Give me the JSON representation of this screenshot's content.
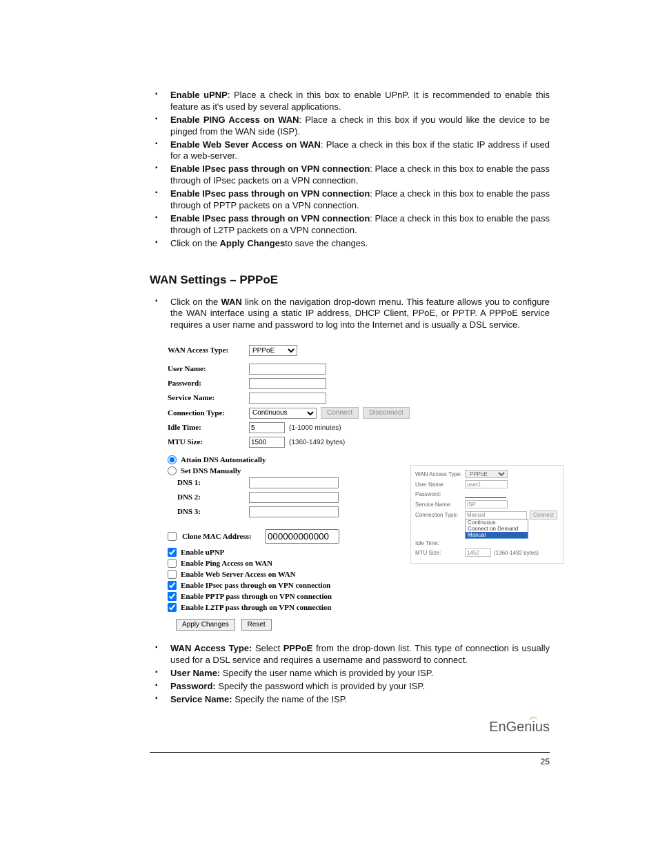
{
  "upper_bullets": [
    {
      "bold": "Enable uPNP",
      "rest": ": Place a check in this box to enable UPnP. It is recommended to enable this feature as it's used by several applications."
    },
    {
      "bold": "Enable PING Access on WAN",
      "rest": ": Place a check in this box if you would like the device to be pinged from the WAN side (ISP)."
    },
    {
      "bold": "Enable Web Sever Access on WAN",
      "rest": ": Place a check in this box if the static IP address if used for a web-server."
    },
    {
      "bold": "Enable IPsec pass through on VPN connection",
      "rest": ": Place a check in this box to enable the pass through of IPsec packets on a VPN connection."
    },
    {
      "bold": "Enable IPsec pass through on VPN connection",
      "rest": ": Place a check in this box to enable the pass through of PPTP packets on a VPN connection."
    },
    {
      "bold": "Enable IPsec pass through on VPN connection",
      "rest": ": Place a check in this box to enable the pass through of L2TP packets on a VPN connection."
    },
    {
      "plain_pre": "Click on the ",
      "bold": "Apply Changes",
      "rest": "to save the changes."
    }
  ],
  "heading": "WAN Settings – PPPoE",
  "wan_intro": {
    "pre": "Click on the ",
    "bold": "WAN",
    "rest": " link on the navigation drop-down menu. This feature allows you to configure the WAN interface using a static IP address, DHCP Client, PPoE, or PPTP. A PPPoE service requires a user name and password to log into the Internet and is usually a DSL service."
  },
  "form": {
    "wan_access_type_label": "WAN Access Type:",
    "wan_access_type_value": "PPPoE",
    "user_name_label": "User Name:",
    "user_name_value": "",
    "password_label": "Password:",
    "password_value": "",
    "service_name_label": "Service Name:",
    "service_name_value": "",
    "connection_type_label": "Connection Type:",
    "connection_type_value": "Continuous",
    "connect_btn": "Connect",
    "disconnect_btn": "Disconnect",
    "idle_time_label": "Idle Time:",
    "idle_time_value": "5",
    "idle_time_hint": "(1-1000 minutes)",
    "mtu_label": "MTU Size:",
    "mtu_value": "1500",
    "mtu_hint": "(1360-1492 bytes)",
    "attain_dns_label": "Attain DNS Automatically",
    "set_dns_label": "Set DNS Manually",
    "dns1_label": "DNS 1:",
    "dns2_label": "DNS 2:",
    "dns3_label": "DNS 3:",
    "clone_mac_label": "Clone MAC Address:",
    "clone_mac_value": "000000000000",
    "upnp_label": "Enable uPNP",
    "ping_label": "Enable Ping Access on WAN",
    "websrv_label": "Enable Web Server Access on WAN",
    "ipsec_label": "Enable IPsec pass through on VPN connection",
    "pptp_label": "Enable PPTP pass through on VPN connection",
    "l2tp_label": "Enable L2TP pass through on VPN connection",
    "apply_btn": "Apply Changes",
    "reset_btn": "Reset"
  },
  "inset": {
    "wan_access_type_label": "WAN Access Type:",
    "wan_access_type_value": "PPPoE",
    "user_name_label": "User Name:",
    "user_name_value": "user1",
    "password_label": "Password:",
    "service_name_label": "Service Name:",
    "service_name_value": "ISP",
    "connection_type_label": "Connection Type:",
    "connection_type_value": "Manual",
    "connect_btn": "Connect",
    "options": [
      "Continuous",
      "Connect on Demand",
      "Manual"
    ],
    "idle_time_label": "Idle Time:",
    "mtu_label": "MTU Size:",
    "mtu_value": "1452",
    "mtu_hint": "(1360-1492 bytes)"
  },
  "lower_bullets": [
    {
      "bold": "WAN Access Type:",
      "mid": " Select ",
      "bold2": "PPPoE",
      "rest": " from the drop-down list. This type of connection is usually used for a DSL service and requires a username and password to connect."
    },
    {
      "bold": "User Name:",
      "rest": " Specify the user name which is provided by your ISP."
    },
    {
      "bold": "Password:",
      "rest": " Specify the password which is provided by your ISP."
    },
    {
      "bold": "Service Name:",
      "rest": " Specify the name of the ISP."
    }
  ],
  "logo": "EnGenius",
  "page_number": "25"
}
